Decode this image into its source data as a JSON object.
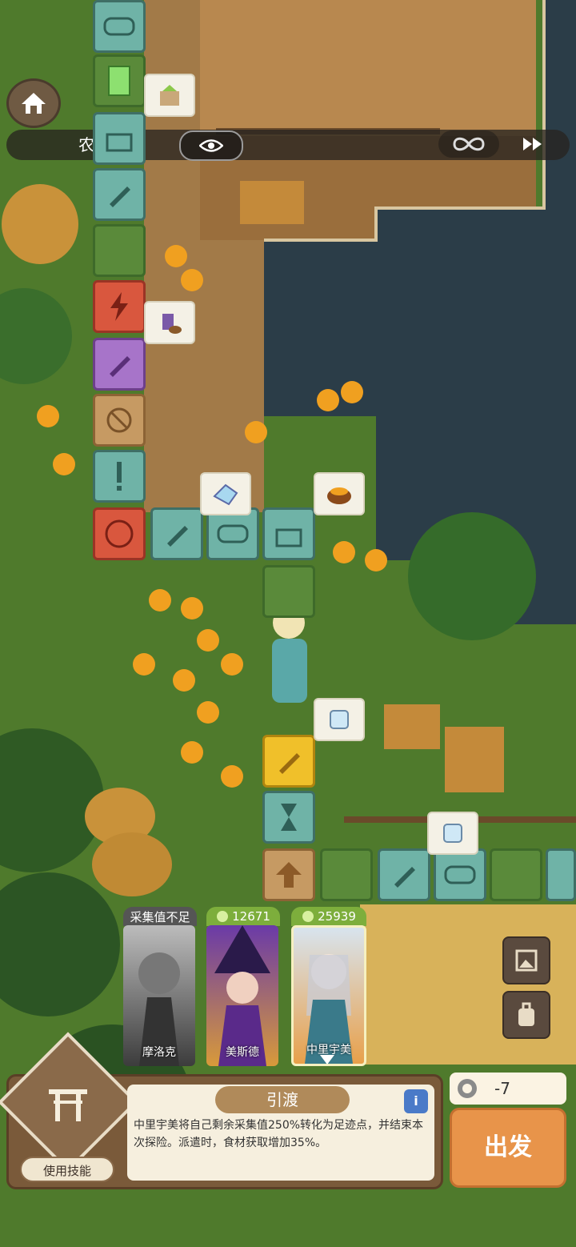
{
  "topbar": {
    "area_name": "农田",
    "eye_icon": "eye-icon",
    "infinity_icon": "infinity-icon",
    "fast_forward_icon": "fast-forward-icon"
  },
  "heroes": [
    {
      "tag": "采集值不足",
      "name": "摩洛克",
      "status": "insufficient"
    },
    {
      "tag": "12671",
      "name": "美斯德"
    },
    {
      "tag": "25939",
      "name": "中里宇美",
      "selected": true
    }
  ],
  "skill": {
    "name": "引渡",
    "description": "中里宇美将自己剩余采集值250%转化为足迹点，并结束本次探险。派遣时，食材获取增加35%。",
    "use_button": "使用技能"
  },
  "cost": {
    "value": "-7"
  },
  "depart_button": "出发",
  "colors": {
    "tile_teal": "#6fb3a7",
    "tile_red": "#d9573e",
    "go_orange": "#e8944a"
  }
}
